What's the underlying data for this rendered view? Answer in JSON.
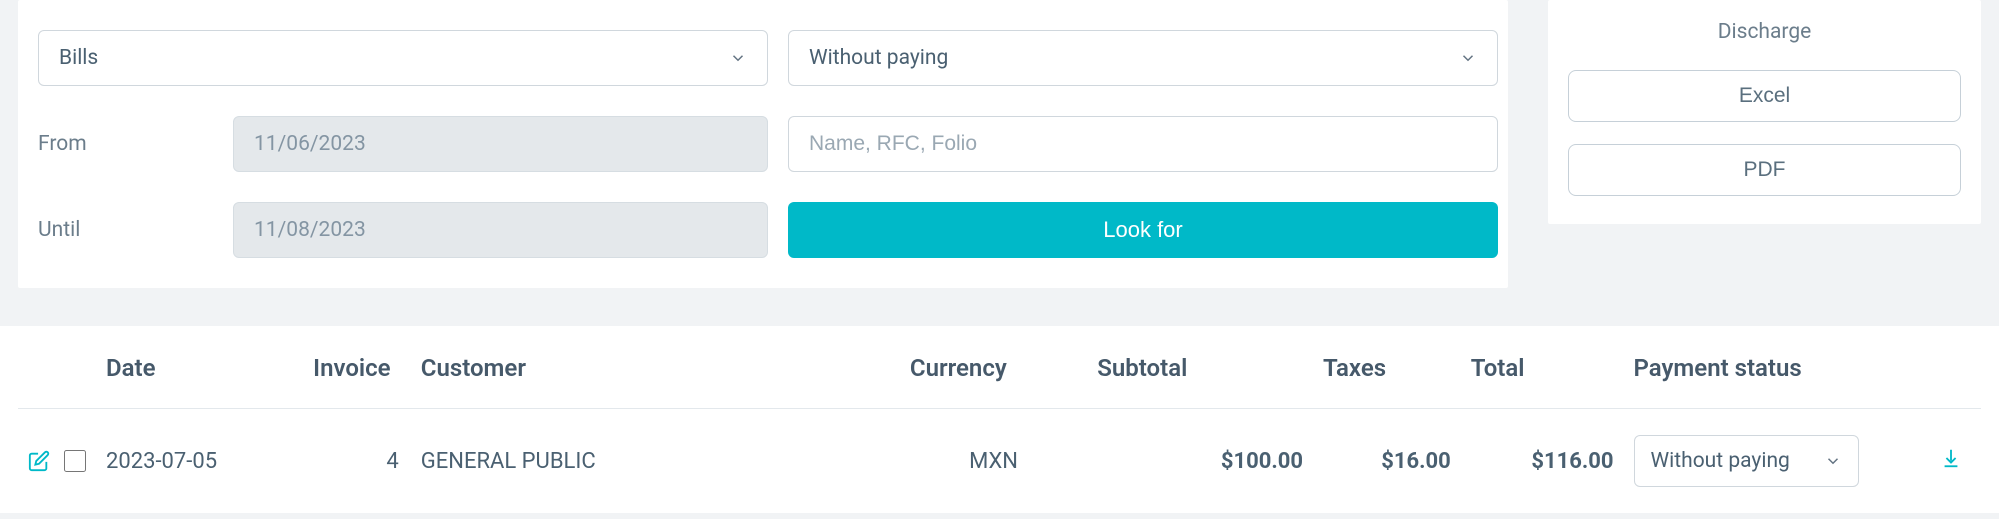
{
  "filters": {
    "type_selected": "Bills",
    "status_selected": "Without paying",
    "from_label": "From",
    "from_value": "11/06/2023",
    "until_label": "Until",
    "until_value": "11/08/2023",
    "search_placeholder": "Name, RFC, Folio",
    "search_button": "Look for"
  },
  "discharge": {
    "title": "Discharge",
    "excel_button": "Excel",
    "pdf_button": "PDF"
  },
  "table": {
    "headers": {
      "date": "Date",
      "invoice": "Invoice",
      "customer": "Customer",
      "currency": "Currency",
      "subtotal": "Subtotal",
      "taxes": "Taxes",
      "total": "Total",
      "payment_status": "Payment status"
    },
    "rows": [
      {
        "date": "2023-07-05",
        "invoice": "4",
        "customer": "GENERAL PUBLIC",
        "currency": "MXN",
        "subtotal": "$100.00",
        "taxes": "$16.00",
        "total": "$116.00",
        "payment_status_selected": "Without paying"
      }
    ]
  }
}
